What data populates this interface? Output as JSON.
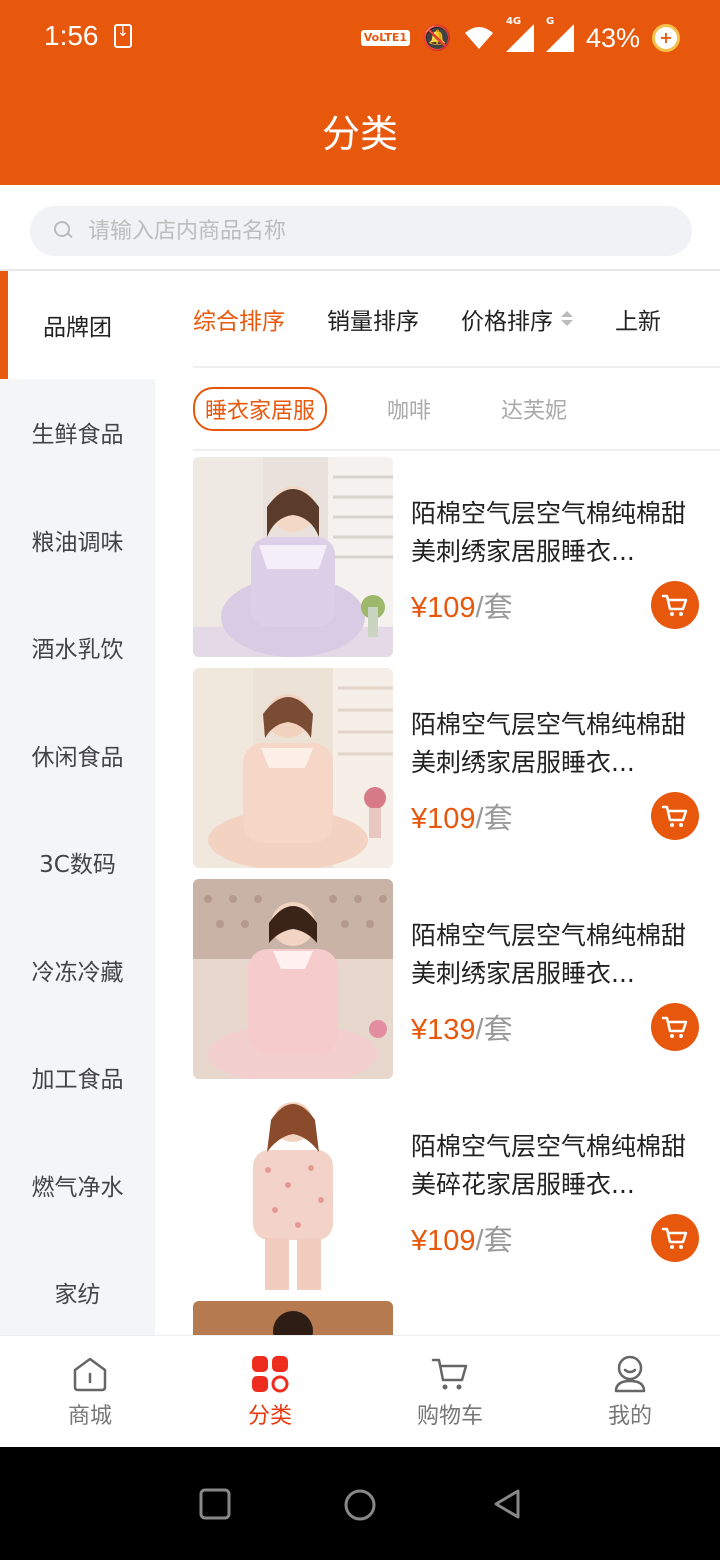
{
  "status_bar": {
    "time": "1:56",
    "volte_label": "VoLTE1",
    "network_4g": "4G",
    "network_g": "G",
    "battery": "43%",
    "icons": [
      "download-icon",
      "mute-bell-icon",
      "wifi-icon",
      "signal-icon",
      "battery-plus-icon"
    ]
  },
  "header": {
    "title": "分类"
  },
  "search": {
    "placeholder": "请输入店内商品名称"
  },
  "sidebar": {
    "items": [
      {
        "label": "品牌团",
        "active": true
      },
      {
        "label": "生鲜食品"
      },
      {
        "label": "粮油调味"
      },
      {
        "label": "酒水乳饮"
      },
      {
        "label": "休闲食品"
      },
      {
        "label": "3C数码"
      },
      {
        "label": "冷冻冷藏"
      },
      {
        "label": "加工食品"
      },
      {
        "label": "燃气净水"
      },
      {
        "label": "家纺"
      }
    ]
  },
  "sort_bar": {
    "items": [
      {
        "label": "综合排序",
        "active": true
      },
      {
        "label": "销量排序"
      },
      {
        "label": "价格排序"
      },
      {
        "label": "上新"
      }
    ]
  },
  "brands": [
    {
      "label": "睡衣家居服",
      "active": true
    },
    {
      "label": "咖啡"
    },
    {
      "label": "达芙妮"
    }
  ],
  "products": [
    {
      "title": "陌棉空气层空气棉纯棉甜美刺绣家居服睡衣...",
      "price": "¥109",
      "unit": "/套",
      "image": "lilac-pajama-photo"
    },
    {
      "title": "陌棉空气层空气棉纯棉甜美刺绣家居服睡衣...",
      "price": "¥109",
      "unit": "/套",
      "image": "peach-pajama-photo"
    },
    {
      "title": "陌棉空气层空气棉纯棉甜美刺绣家居服睡衣...",
      "price": "¥139",
      "unit": "/套",
      "image": "pink-quilted-pajama-photo"
    },
    {
      "title": "陌棉空气层空气棉纯棉甜美碎花家居服睡衣...",
      "price": "¥109",
      "unit": "/套",
      "image": "floral-pajama-photo"
    }
  ],
  "bottom_nav": {
    "items": [
      {
        "label": "商城",
        "icon": "home-icon"
      },
      {
        "label": "分类",
        "icon": "category-icon",
        "active": true
      },
      {
        "label": "购物车",
        "icon": "cart-icon"
      },
      {
        "label": "我的",
        "icon": "profile-icon"
      }
    ]
  },
  "colors": {
    "brand": "#e8580c",
    "price": "#e8580c",
    "nav_active": "#e8380c"
  }
}
